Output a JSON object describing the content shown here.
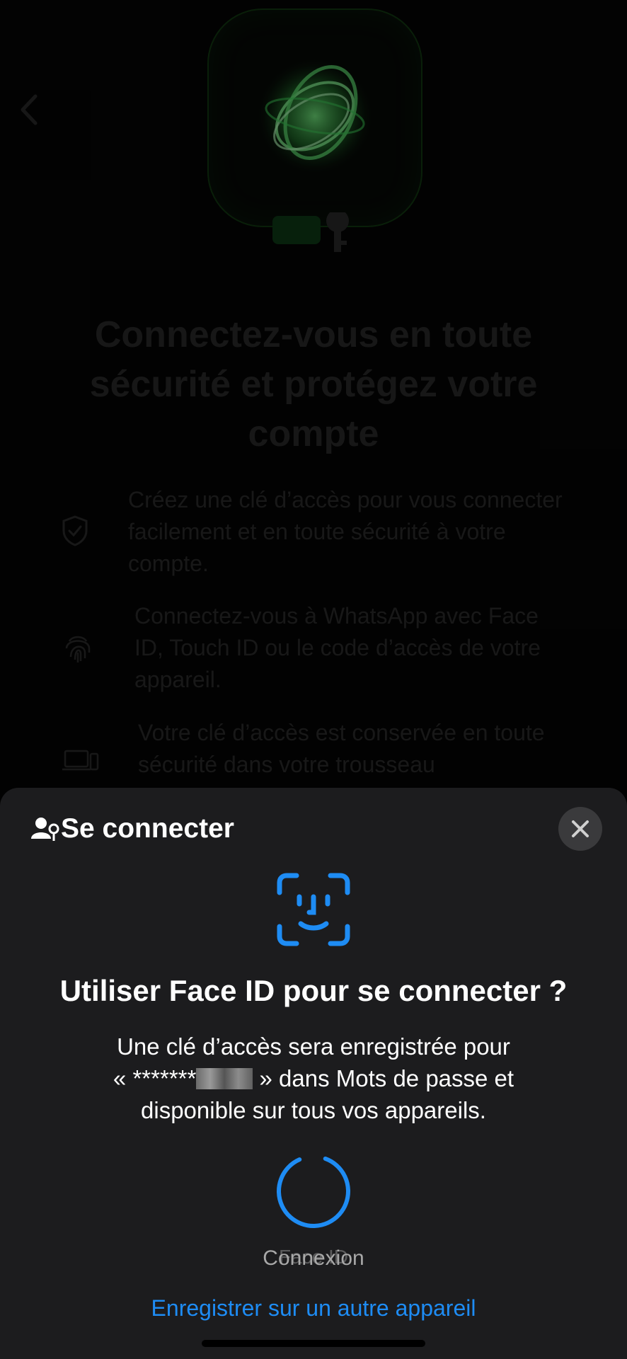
{
  "background": {
    "headline": "Connectez-vous en toute sécurité et protégez votre compte",
    "features": [
      {
        "icon": "shield-check-icon",
        "text": "Créez une clé d’accès pour vous connecter facilement et en toute sécurité à votre compte."
      },
      {
        "icon": "fingerprint-icon",
        "text": "Connectez-vous à WhatsApp avec Face ID, Touch ID ou le code d’accès de votre appareil."
      },
      {
        "icon": "devices-icon",
        "text": "Votre clé d’accès est conservée en toute sécurité dans votre trousseau"
      }
    ]
  },
  "sheet": {
    "title": "Se connecter",
    "prompt_title": "Utiliser Face ID pour se connecter ?",
    "prompt_desc_part1": "Une clé d’accès sera enregistrée pour",
    "prompt_desc_prefix": "« *******",
    "prompt_desc_suffix": " » dans Mots de passe et",
    "prompt_desc_part3": "disponible sur tous vos appareils.",
    "status_label": "Connexion",
    "status_label_ghost": "Face ID",
    "alt_link": "Enregistrer sur un autre appareil"
  },
  "colors": {
    "accent": "#1E8CF4",
    "sheet_bg": "#1C1C1E",
    "hero_green": "#3FD45A"
  }
}
